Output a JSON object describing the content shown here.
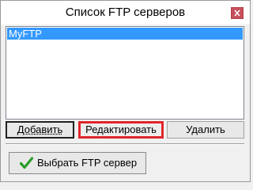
{
  "window": {
    "title": "Список FTP серверов",
    "close_icon": "close-icon"
  },
  "server_list": {
    "items": [
      {
        "label": "MyFTP",
        "selected": true
      }
    ]
  },
  "buttons": {
    "add_label": "Добавить",
    "edit_label": "Редактировать",
    "delete_label": "Удалить",
    "select_label": "Выбрать FTP сервер",
    "select_icon": "checkmark-icon"
  },
  "colors": {
    "selection": "#3399ff",
    "close_button": "#c7505c",
    "highlight_frame": "#e0262a",
    "check_green": "#2a9d2a"
  }
}
